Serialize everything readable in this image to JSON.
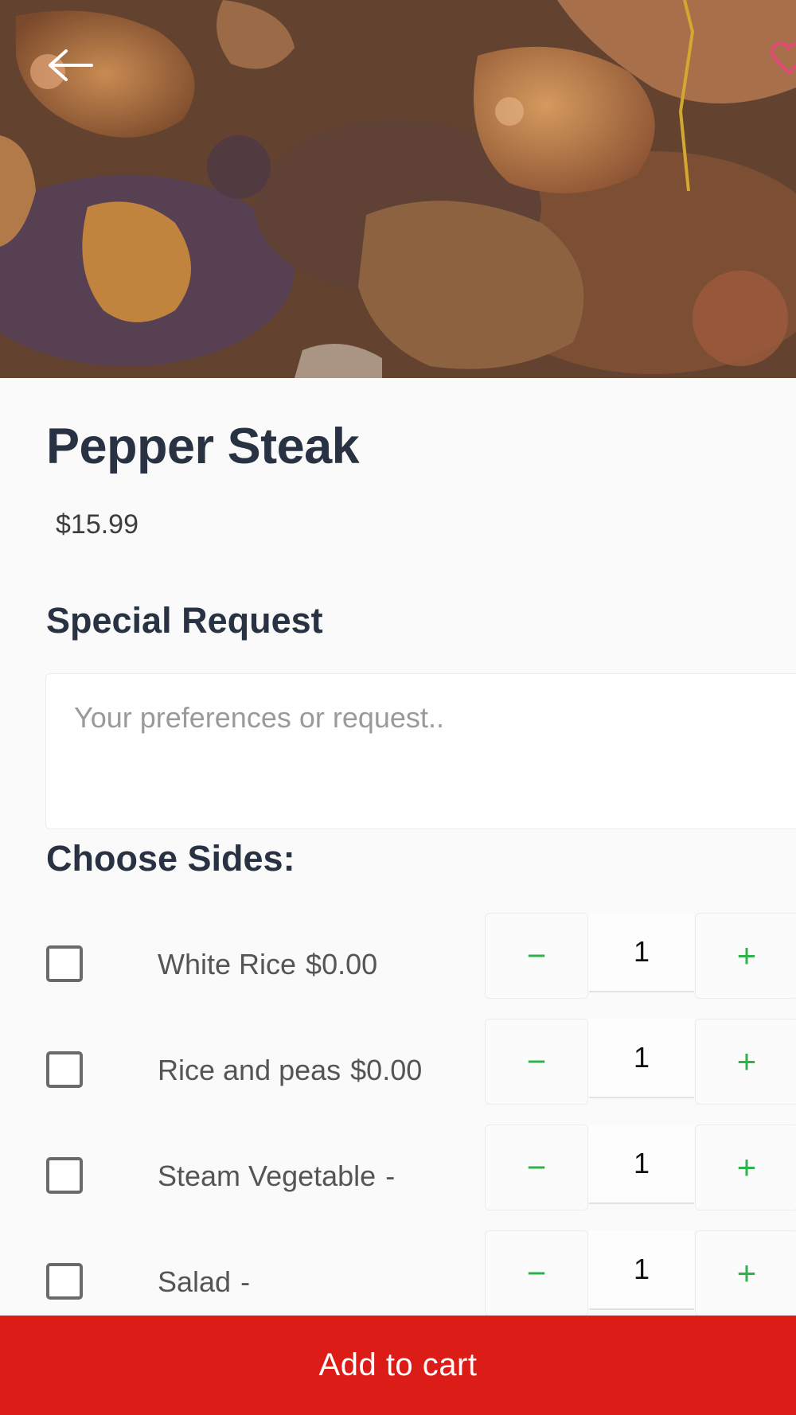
{
  "item": {
    "name": "Pepper Steak",
    "price": "$15.99"
  },
  "special_request": {
    "title": "Special Request",
    "placeholder": "Your preferences or request.."
  },
  "sides": {
    "title": "Choose Sides:",
    "items": [
      {
        "name": "White Rice",
        "price": "$0.00",
        "qty": "1",
        "checked": false
      },
      {
        "name": "Rice and peas",
        "price": "$0.00",
        "qty": "1",
        "checked": false
      },
      {
        "name": "Steam Vegetable",
        "price": "-",
        "qty": "1",
        "checked": false
      },
      {
        "name": "Salad",
        "price": "-",
        "qty": "1",
        "checked": false
      }
    ],
    "minus_glyph": "−",
    "plus_glyph": "+"
  },
  "actions": {
    "add_to_cart": "Add to cart"
  },
  "colors": {
    "primary_red": "#dc1c17",
    "stepper_green": "#2fb24a",
    "heading": "#283242",
    "favorite_pink": "#e8457a"
  },
  "icons": {
    "back": "arrow-left-icon",
    "favorite": "heart-icon"
  }
}
